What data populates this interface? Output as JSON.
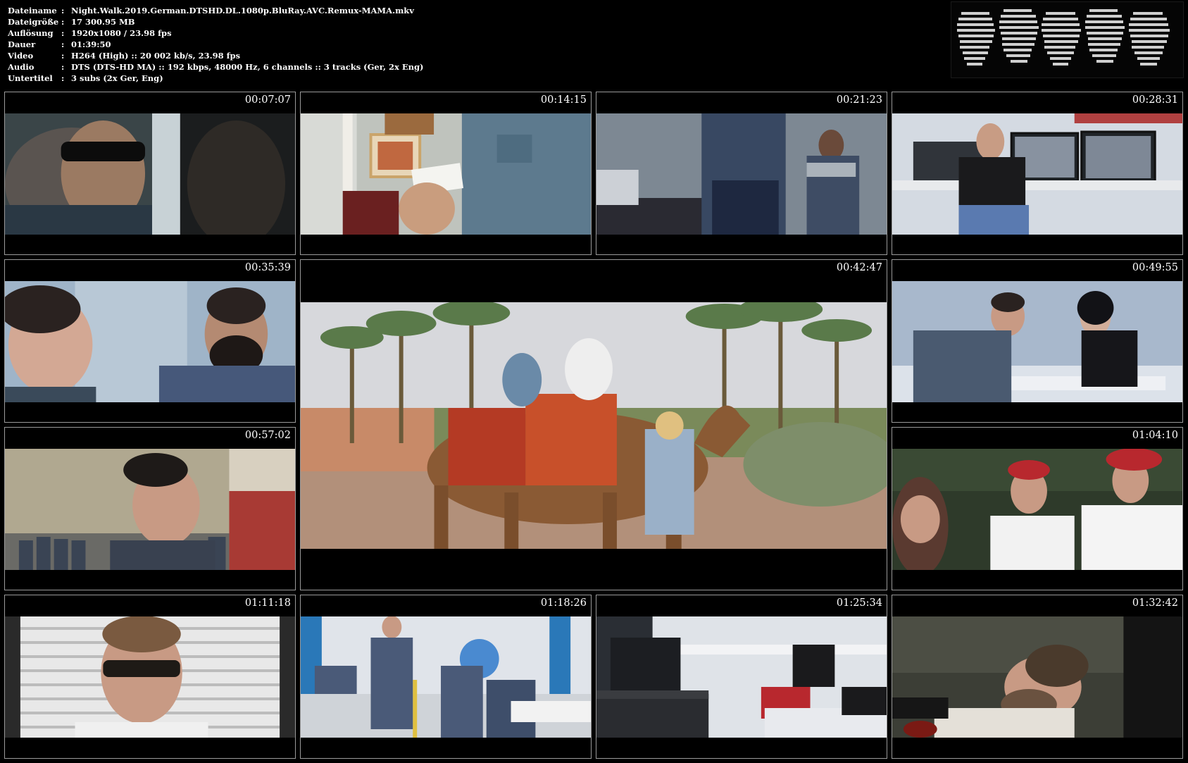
{
  "info": [
    {
      "key": "Dateiname",
      "value": "Night.Walk.2019.German.DTSHD.DL.1080p.BluRay.AVC.Remux-MAMA.mkv"
    },
    {
      "key": "Dateigröße",
      "value": "17 300.95 MB"
    },
    {
      "key": "Auflösung",
      "value": "1920x1080 / 23.98 fps"
    },
    {
      "key": "Dauer",
      "value": "01:39:50"
    },
    {
      "key": "Video",
      "value": "H264 (High) :: 20 002 kb/s, 23.98 fps"
    },
    {
      "key": "Audio",
      "value": "DTS (DTS-HD MA) :: 192 kbps, 48000 Hz, 6 channels :: 3 tracks (Ger, 2x Eng)"
    },
    {
      "key": "Untertitel",
      "value": "3 subs (2x Ger, Eng)"
    }
  ],
  "separator": ":",
  "logo_icon": "ascii-art-logo",
  "thumbnails": [
    {
      "timestamp": "00:07:07",
      "scene": "man-sunglasses"
    },
    {
      "timestamp": "00:14:15",
      "scene": "hand-card-shelf"
    },
    {
      "timestamp": "00:21:23",
      "scene": "prison-cell"
    },
    {
      "timestamp": "00:28:31",
      "scene": "security-room"
    },
    {
      "timestamp": "00:35:39",
      "scene": "bearded-man"
    },
    {
      "timestamp": "00:42:47",
      "scene": "camel-ride"
    },
    {
      "timestamp": "00:49:55",
      "scene": "interrogation"
    },
    {
      "timestamp": "00:57:02",
      "scene": "prison-yard"
    },
    {
      "timestamp": "01:04:10",
      "scene": "police-officers"
    },
    {
      "timestamp": "01:11:18",
      "scene": "man-glasses"
    },
    {
      "timestamp": "01:18:26",
      "scene": "prison-canteen"
    },
    {
      "timestamp": "01:25:34",
      "scene": "office"
    },
    {
      "timestamp": "01:32:42",
      "scene": "lying-man"
    }
  ]
}
